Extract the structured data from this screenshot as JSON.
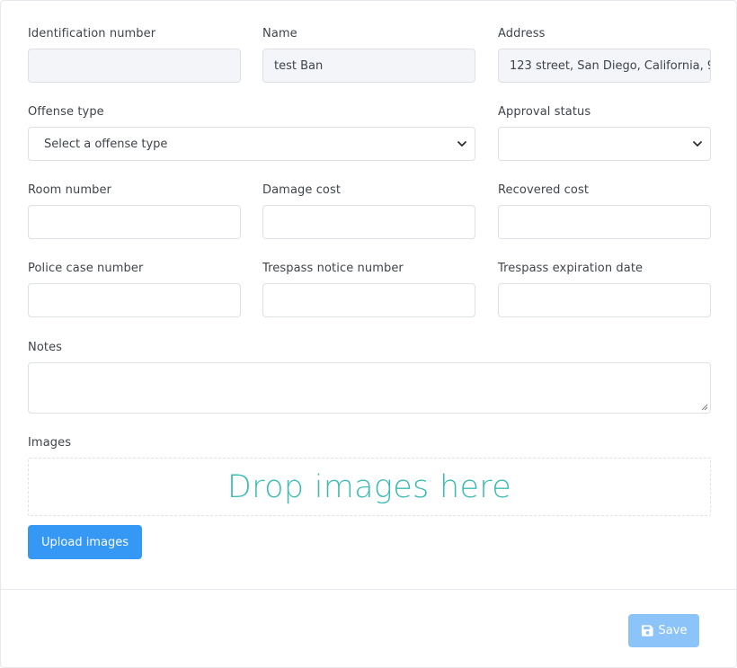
{
  "fields": {
    "identification_number": {
      "label": "Identification number",
      "value": ""
    },
    "name": {
      "label": "Name",
      "value": "test Ban"
    },
    "address": {
      "label": "Address",
      "value": "123 street, San Diego, California, 9"
    },
    "offense_type": {
      "label": "Offense type",
      "selected": "Select a offense type"
    },
    "approval_status": {
      "label": "Approval status",
      "selected": ""
    },
    "room_number": {
      "label": "Room number",
      "value": ""
    },
    "damage_cost": {
      "label": "Damage cost",
      "value": ""
    },
    "recovered_cost": {
      "label": "Recovered cost",
      "value": ""
    },
    "police_case_number": {
      "label": "Police case number",
      "value": ""
    },
    "trespass_notice_number": {
      "label": "Trespass notice number",
      "value": ""
    },
    "trespass_expiration_date": {
      "label": "Trespass expiration date",
      "value": ""
    },
    "notes": {
      "label": "Notes",
      "value": ""
    }
  },
  "images": {
    "label": "Images",
    "dropzone_text": "Drop images here",
    "upload_button": "Upload images"
  },
  "footer": {
    "save_label": "Save"
  },
  "colors": {
    "primary": "#3598f5",
    "primary_disabled": "#8cc4f9",
    "dropzone_text": "#3dbcb4",
    "readonly_bg": "#f3f5f8"
  }
}
